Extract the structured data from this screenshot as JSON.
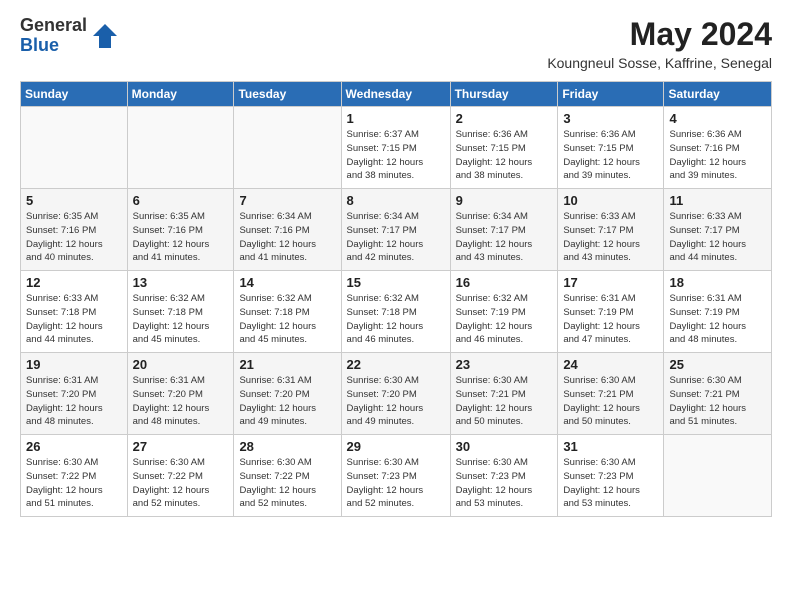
{
  "logo": {
    "general": "General",
    "blue": "Blue"
  },
  "title": {
    "month_year": "May 2024",
    "location": "Koungneul Sosse, Kaffrine, Senegal"
  },
  "headers": [
    "Sunday",
    "Monday",
    "Tuesday",
    "Wednesday",
    "Thursday",
    "Friday",
    "Saturday"
  ],
  "weeks": [
    {
      "rowClass": "row-even",
      "days": [
        {
          "number": "",
          "info": ""
        },
        {
          "number": "",
          "info": ""
        },
        {
          "number": "",
          "info": ""
        },
        {
          "number": "1",
          "info": "Sunrise: 6:37 AM\nSunset: 7:15 PM\nDaylight: 12 hours\nand 38 minutes."
        },
        {
          "number": "2",
          "info": "Sunrise: 6:36 AM\nSunset: 7:15 PM\nDaylight: 12 hours\nand 38 minutes."
        },
        {
          "number": "3",
          "info": "Sunrise: 6:36 AM\nSunset: 7:15 PM\nDaylight: 12 hours\nand 39 minutes."
        },
        {
          "number": "4",
          "info": "Sunrise: 6:36 AM\nSunset: 7:16 PM\nDaylight: 12 hours\nand 39 minutes."
        }
      ]
    },
    {
      "rowClass": "row-odd",
      "days": [
        {
          "number": "5",
          "info": "Sunrise: 6:35 AM\nSunset: 7:16 PM\nDaylight: 12 hours\nand 40 minutes."
        },
        {
          "number": "6",
          "info": "Sunrise: 6:35 AM\nSunset: 7:16 PM\nDaylight: 12 hours\nand 41 minutes."
        },
        {
          "number": "7",
          "info": "Sunrise: 6:34 AM\nSunset: 7:16 PM\nDaylight: 12 hours\nand 41 minutes."
        },
        {
          "number": "8",
          "info": "Sunrise: 6:34 AM\nSunset: 7:17 PM\nDaylight: 12 hours\nand 42 minutes."
        },
        {
          "number": "9",
          "info": "Sunrise: 6:34 AM\nSunset: 7:17 PM\nDaylight: 12 hours\nand 43 minutes."
        },
        {
          "number": "10",
          "info": "Sunrise: 6:33 AM\nSunset: 7:17 PM\nDaylight: 12 hours\nand 43 minutes."
        },
        {
          "number": "11",
          "info": "Sunrise: 6:33 AM\nSunset: 7:17 PM\nDaylight: 12 hours\nand 44 minutes."
        }
      ]
    },
    {
      "rowClass": "row-even",
      "days": [
        {
          "number": "12",
          "info": "Sunrise: 6:33 AM\nSunset: 7:18 PM\nDaylight: 12 hours\nand 44 minutes."
        },
        {
          "number": "13",
          "info": "Sunrise: 6:32 AM\nSunset: 7:18 PM\nDaylight: 12 hours\nand 45 minutes."
        },
        {
          "number": "14",
          "info": "Sunrise: 6:32 AM\nSunset: 7:18 PM\nDaylight: 12 hours\nand 45 minutes."
        },
        {
          "number": "15",
          "info": "Sunrise: 6:32 AM\nSunset: 7:18 PM\nDaylight: 12 hours\nand 46 minutes."
        },
        {
          "number": "16",
          "info": "Sunrise: 6:32 AM\nSunset: 7:19 PM\nDaylight: 12 hours\nand 46 minutes."
        },
        {
          "number": "17",
          "info": "Sunrise: 6:31 AM\nSunset: 7:19 PM\nDaylight: 12 hours\nand 47 minutes."
        },
        {
          "number": "18",
          "info": "Sunrise: 6:31 AM\nSunset: 7:19 PM\nDaylight: 12 hours\nand 48 minutes."
        }
      ]
    },
    {
      "rowClass": "row-odd",
      "days": [
        {
          "number": "19",
          "info": "Sunrise: 6:31 AM\nSunset: 7:20 PM\nDaylight: 12 hours\nand 48 minutes."
        },
        {
          "number": "20",
          "info": "Sunrise: 6:31 AM\nSunset: 7:20 PM\nDaylight: 12 hours\nand 48 minutes."
        },
        {
          "number": "21",
          "info": "Sunrise: 6:31 AM\nSunset: 7:20 PM\nDaylight: 12 hours\nand 49 minutes."
        },
        {
          "number": "22",
          "info": "Sunrise: 6:30 AM\nSunset: 7:20 PM\nDaylight: 12 hours\nand 49 minutes."
        },
        {
          "number": "23",
          "info": "Sunrise: 6:30 AM\nSunset: 7:21 PM\nDaylight: 12 hours\nand 50 minutes."
        },
        {
          "number": "24",
          "info": "Sunrise: 6:30 AM\nSunset: 7:21 PM\nDaylight: 12 hours\nand 50 minutes."
        },
        {
          "number": "25",
          "info": "Sunrise: 6:30 AM\nSunset: 7:21 PM\nDaylight: 12 hours\nand 51 minutes."
        }
      ]
    },
    {
      "rowClass": "row-even",
      "days": [
        {
          "number": "26",
          "info": "Sunrise: 6:30 AM\nSunset: 7:22 PM\nDaylight: 12 hours\nand 51 minutes."
        },
        {
          "number": "27",
          "info": "Sunrise: 6:30 AM\nSunset: 7:22 PM\nDaylight: 12 hours\nand 52 minutes."
        },
        {
          "number": "28",
          "info": "Sunrise: 6:30 AM\nSunset: 7:22 PM\nDaylight: 12 hours\nand 52 minutes."
        },
        {
          "number": "29",
          "info": "Sunrise: 6:30 AM\nSunset: 7:23 PM\nDaylight: 12 hours\nand 52 minutes."
        },
        {
          "number": "30",
          "info": "Sunrise: 6:30 AM\nSunset: 7:23 PM\nDaylight: 12 hours\nand 53 minutes."
        },
        {
          "number": "31",
          "info": "Sunrise: 6:30 AM\nSunset: 7:23 PM\nDaylight: 12 hours\nand 53 minutes."
        },
        {
          "number": "",
          "info": ""
        }
      ]
    }
  ]
}
